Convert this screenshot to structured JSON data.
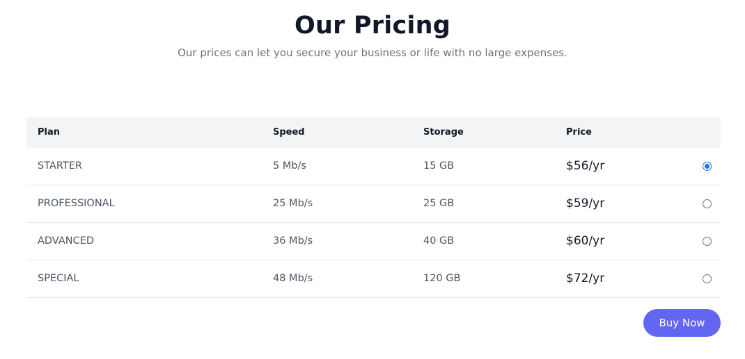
{
  "header": {
    "title": "Our Pricing",
    "subtitle": "Our prices can let you secure your business or life with no large expenses."
  },
  "table": {
    "columns": {
      "plan": "Plan",
      "speed": "Speed",
      "storage": "Storage",
      "price": "Price"
    },
    "rows": [
      {
        "plan": "STARTER",
        "speed": "5 Mb/s",
        "storage": "15 GB",
        "price": "$56/yr",
        "selected": true
      },
      {
        "plan": "PROFESSIONAL",
        "speed": "25 Mb/s",
        "storage": "25 GB",
        "price": "$59/yr",
        "selected": false
      },
      {
        "plan": "ADVANCED",
        "speed": "36 Mb/s",
        "storage": "40 GB",
        "price": "$60/yr",
        "selected": false
      },
      {
        "plan": "SPECIAL",
        "speed": "48 Mb/s",
        "storage": "120 GB",
        "price": "$72/yr",
        "selected": false
      }
    ]
  },
  "actions": {
    "buy_label": "Buy Now"
  },
  "colors": {
    "accent": "#6366f1",
    "radio_selected": "#1a73e8",
    "header_bg": "#f3f4f6"
  }
}
